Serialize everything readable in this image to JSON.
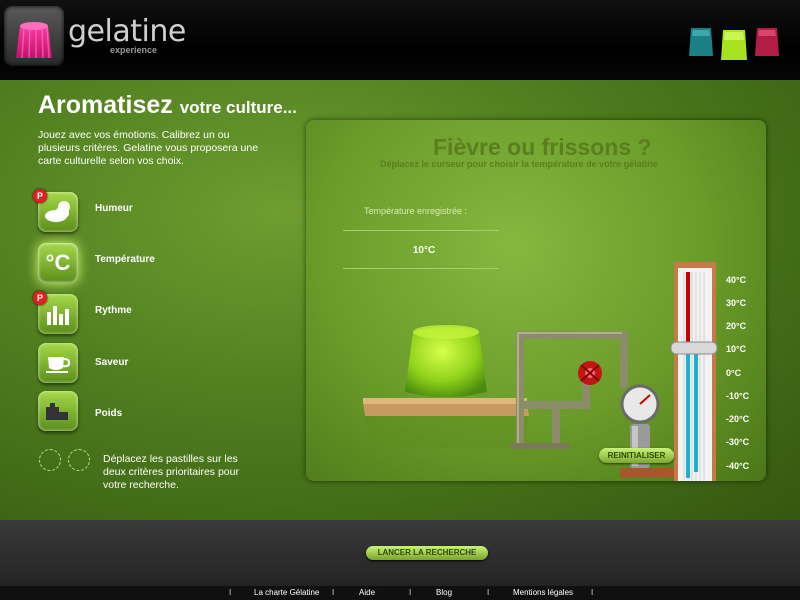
{
  "header": {
    "logo_text": "gelatine",
    "logo_sub": "experience",
    "jar_colors": [
      "#1a8a8a",
      "#a6e020",
      "#c8204a"
    ]
  },
  "main": {
    "title": "Aromatisez",
    "title_rest": "votre culture...",
    "intro": "Jouez avec vos émotions. Calibrez un ou plusieurs critères. Gelatine vous proposera une carte culturelle selon vos choix.",
    "criteria": [
      {
        "label": "Humeur",
        "icon": "cloud-sun-icon",
        "badge": "P"
      },
      {
        "label": "Température",
        "icon": "celsius-icon",
        "glyph": "°C",
        "selected": true
      },
      {
        "label": "Rythme",
        "icon": "bars-icon",
        "badge": "P"
      },
      {
        "label": "Saveur",
        "icon": "cup-icon"
      },
      {
        "label": "Poids",
        "icon": "weight-icon"
      }
    ],
    "hint": "Déplacez les pastilles sur les deux critères prioritaires pour votre recherche."
  },
  "panel": {
    "title": "Fièvre ou frissons ?",
    "subtitle": "Déplacez le curseur pour choisir la température de votre gélatine",
    "temp_label": "Température enregistrée :",
    "temp_value": "10°C",
    "reset_label": "REINITIALISER",
    "scale": [
      "40°C",
      "30°C",
      "20°C",
      "10°C",
      "0°C",
      "-10°C",
      "-20°C",
      "-30°C",
      "-40°C"
    ],
    "slider_level_celsius": 10
  },
  "footer": {
    "launch_label": "LANCER LA RECHERCHE",
    "links": [
      "La charte Gélatine",
      "Aide",
      "Blog",
      "Mentions légales"
    ],
    "separator": "I"
  }
}
